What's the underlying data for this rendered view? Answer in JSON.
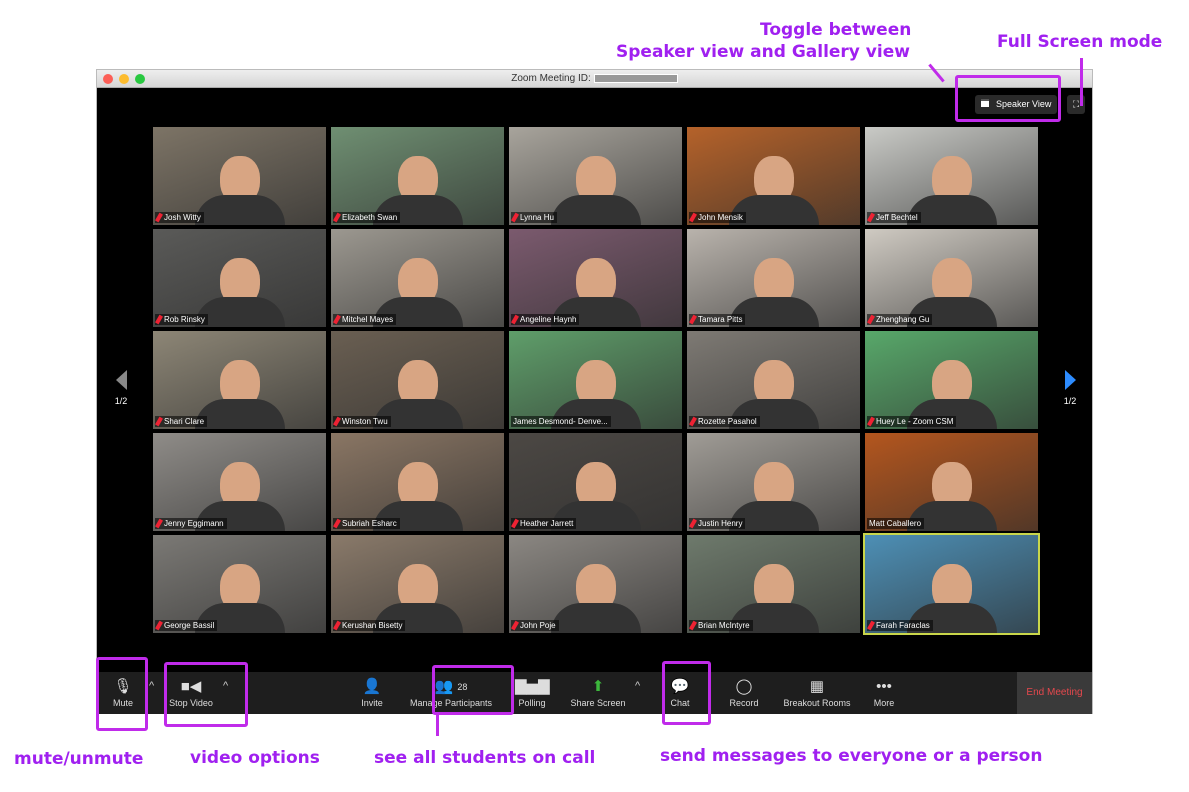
{
  "window": {
    "title": "Zoom Meeting ID:",
    "speaker_view": "Speaker View",
    "fullscreen_icon": "expand-icon"
  },
  "pager": {
    "left": "1/2",
    "right": "1/2"
  },
  "participants": [
    {
      "name": "Josh Witty",
      "muted": true,
      "bg": "#7d7466"
    },
    {
      "name": "Elizabeth Swan",
      "muted": true,
      "bg": "#6f8f72"
    },
    {
      "name": "Lynna Hu",
      "muted": true,
      "bg": "#a8a49c"
    },
    {
      "name": "John Mensik",
      "muted": true,
      "bg": "#b5622a"
    },
    {
      "name": "Jeff Bechtel",
      "muted": true,
      "bg": "#c9cac6"
    },
    {
      "name": "Rob Rinsky",
      "muted": true,
      "bg": "#5a5a58"
    },
    {
      "name": "Mitchel Mayes",
      "muted": true,
      "bg": "#9c9890"
    },
    {
      "name": "Angeline Haynh",
      "muted": true,
      "bg": "#7b5a6e"
    },
    {
      "name": "Tamara Pitts",
      "muted": true,
      "bg": "#b9b3ac"
    },
    {
      "name": "Zhenghang Gu",
      "muted": true,
      "bg": "#cfcac2"
    },
    {
      "name": "Shari Clare",
      "muted": true,
      "bg": "#8d8676"
    },
    {
      "name": "Winston Twu",
      "muted": true,
      "bg": "#6a5f52"
    },
    {
      "name": "James Desmond- Denve...",
      "muted": false,
      "bg": "#5f9e6a"
    },
    {
      "name": "Rozette Pasahol",
      "muted": true,
      "bg": "#7e7a74"
    },
    {
      "name": "Huey Le - Zoom CSM",
      "muted": true,
      "bg": "#58a86a"
    },
    {
      "name": "Jenny Eggimann",
      "muted": true,
      "bg": "#8f8c88"
    },
    {
      "name": "Subriah Esharc",
      "muted": true,
      "bg": "#8a7664"
    },
    {
      "name": "Heather Jarrett",
      "muted": true,
      "bg": "#4c4844"
    },
    {
      "name": "Justin Henry",
      "muted": true,
      "bg": "#a09c96"
    },
    {
      "name": "Matt Caballero",
      "muted": false,
      "bg": "#b4561e"
    },
    {
      "name": "George Bassil",
      "muted": true,
      "bg": "#7b7975"
    },
    {
      "name": "Kerushan Bisetty",
      "muted": true,
      "bg": "#8a7a6a"
    },
    {
      "name": "John Poje",
      "muted": true,
      "bg": "#8b8782"
    },
    {
      "name": "Brian McIntyre",
      "muted": true,
      "bg": "#6e7a6c"
    },
    {
      "name": "Farah Faraclas",
      "muted": true,
      "bg": "#4d8fb5",
      "active": true
    }
  ],
  "toolbar": {
    "mute": "Mute",
    "stop_video": "Stop Video",
    "invite": "Invite",
    "participants": "Manage Participants",
    "participant_count": "28",
    "polling": "Polling",
    "share_screen": "Share Screen",
    "chat": "Chat",
    "record": "Record",
    "breakout": "Breakout Rooms",
    "more": "More",
    "end": "End Meeting"
  },
  "annotations": {
    "toggle_line1": "Toggle between",
    "toggle_line2": "Speaker view and Gallery view",
    "fullscreen": "Full Screen mode",
    "mute": "mute/unmute",
    "video": "video options",
    "participants": "see all students on call",
    "chat": "send messages to everyone or a person"
  },
  "colors": {
    "annotation": "#a020f0",
    "active_speaker": "#c9d64a",
    "end_meeting": "#e5484d",
    "share_screen": "#3cb83c"
  }
}
